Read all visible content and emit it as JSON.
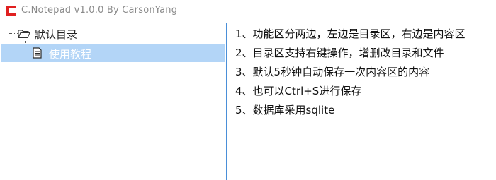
{
  "window": {
    "title": "C.Notepad v1.0.0 By CarsonYang",
    "icon": "app-logo-icon",
    "accent_color": "#e02020"
  },
  "tree": {
    "root": {
      "label": "默认目录",
      "icon": "folder-open-icon"
    },
    "children": [
      {
        "label": "使用教程",
        "icon": "document-icon",
        "selected": true
      }
    ],
    "selection_color": "#b3d5f7"
  },
  "editor": {
    "lines": [
      "1、功能区分两边，左边是目录区，右边是内容区",
      "2、目录区支持右键操作，增删改目录和文件",
      "3、默认5秒钟自动保存一次内容区的内容",
      "4、也可以Ctrl+S进行保存",
      "5、数据库采用sqlite"
    ]
  }
}
